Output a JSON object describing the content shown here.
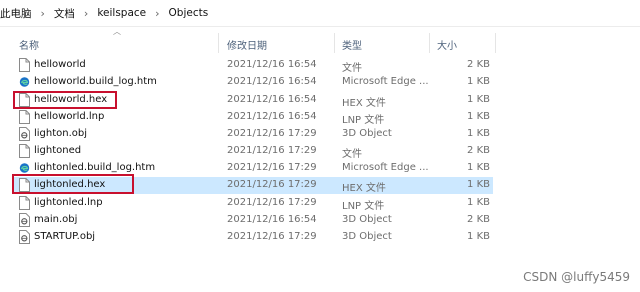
{
  "breadcrumb": {
    "segments": [
      "此电脑",
      "文档",
      "keilspace",
      "Objects"
    ],
    "separator": "›"
  },
  "columns": {
    "name": "名称",
    "date": "修改日期",
    "type": "类型",
    "size": "大小"
  },
  "files": [
    {
      "name": "helloworld",
      "date": "2021/12/16 16:54",
      "type": "文件",
      "size": "2 KB",
      "icon": "blank-file-icon"
    },
    {
      "name": "helloworld.build_log.htm",
      "date": "2021/12/16 16:54",
      "type": "Microsoft Edge ...",
      "size": "1 KB",
      "icon": "edge-icon"
    },
    {
      "name": "helloworld.hex",
      "date": "2021/12/16 16:54",
      "type": "HEX 文件",
      "size": "1 KB",
      "icon": "blank-file-icon"
    },
    {
      "name": "helloworld.lnp",
      "date": "2021/12/16 16:54",
      "type": "LNP 文件",
      "size": "1 KB",
      "icon": "blank-file-icon"
    },
    {
      "name": "lighton.obj",
      "date": "2021/12/16 17:29",
      "type": "3D Object",
      "size": "1 KB",
      "icon": "3d-object-icon"
    },
    {
      "name": "lightoned",
      "date": "2021/12/16 17:29",
      "type": "文件",
      "size": "2 KB",
      "icon": "blank-file-icon"
    },
    {
      "name": "lightonled.build_log.htm",
      "date": "2021/12/16 17:29",
      "type": "Microsoft Edge ...",
      "size": "1 KB",
      "icon": "edge-icon"
    },
    {
      "name": "lightonled.hex",
      "date": "2021/12/16 17:29",
      "type": "HEX 文件",
      "size": "1 KB",
      "icon": "blank-file-icon",
      "selected": true
    },
    {
      "name": "lightonled.lnp",
      "date": "2021/12/16 17:29",
      "type": "LNP 文件",
      "size": "1 KB",
      "icon": "blank-file-icon"
    },
    {
      "name": "main.obj",
      "date": "2021/12/16 16:54",
      "type": "3D Object",
      "size": "2 KB",
      "icon": "3d-object-icon"
    },
    {
      "name": "STARTUP.obj",
      "date": "2021/12/16 17:29",
      "type": "3D Object",
      "size": "1 KB",
      "icon": "3d-object-icon"
    }
  ],
  "watermark": "CSDN @luffy5459",
  "colors": {
    "selection": "#cce8ff",
    "highlight_box": "#c8102e",
    "edge_blue": "#1a73c8"
  }
}
